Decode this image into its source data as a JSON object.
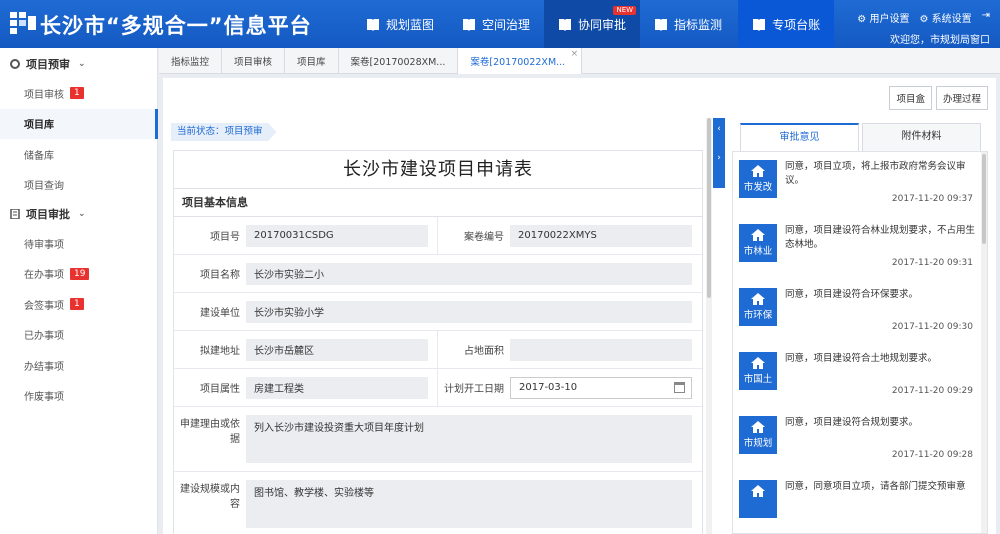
{
  "brand": {
    "title": "长沙市“多规合一”信息平台"
  },
  "nav": [
    {
      "label": "规划蓝图",
      "icon": "book-icon"
    },
    {
      "label": "空间治理",
      "icon": "book-icon"
    },
    {
      "label": "协同审批",
      "icon": "book-icon",
      "badge": "NEW"
    },
    {
      "label": "指标监测",
      "icon": "book-icon"
    },
    {
      "label": "专项台账",
      "icon": "book-icon"
    }
  ],
  "topright": {
    "user_settings": "用户设置",
    "system_settings": "系统设置",
    "welcome": "欢迎您，市规划局窗口"
  },
  "sidebar": {
    "group1": {
      "label": "项目预审"
    },
    "group1_items": [
      {
        "label": "项目审核",
        "badge": "1"
      },
      {
        "label": "项目库"
      },
      {
        "label": "储备库"
      },
      {
        "label": "项目查询"
      }
    ],
    "group2": {
      "label": "项目审批"
    },
    "group2_items": [
      {
        "label": "待审事项"
      },
      {
        "label": "在办事项",
        "badge": "19"
      },
      {
        "label": "会签事项",
        "badge": "1"
      },
      {
        "label": "已办事项"
      },
      {
        "label": "办结事项"
      },
      {
        "label": "作废事项"
      }
    ]
  },
  "tabs": [
    "指标监控",
    "项目审核",
    "项目库",
    "案卷[20170028XM...",
    "案卷[20170022XM..."
  ],
  "toolbar": {
    "project_box": "项目盒",
    "process": "办理过程"
  },
  "status": "当前状态：项目预审",
  "form": {
    "title": "长沙市建设项目申请表",
    "section": "项目基本信息",
    "project_no_label": "项目号",
    "project_no": "20170031CSDG",
    "case_no_label": "案卷编号",
    "case_no": "20170022XMYS",
    "name_label": "项目名称",
    "name": "长沙市实验二小",
    "unit_label": "建设单位",
    "unit": "长沙市实验小学",
    "address_label": "拟建地址",
    "address": "长沙市岳麓区",
    "area_label": "占地面积",
    "area": "",
    "attr_label": "项目属性",
    "attr": "房建工程类",
    "start_label": "计划开工日期",
    "start": "2017-03-10",
    "reason_label": "申建理由或依据",
    "reason": "列入长沙市建设投资重大项目年度计划",
    "scale_label": "建设规模或内容",
    "scale": "图书馆、教学楼、实验楼等"
  },
  "right": {
    "tab_opinions": "审批意见",
    "tab_materials": "附件材料",
    "opinions": [
      {
        "dept": "市发改",
        "text": "同意，项目立项，将上报市政府常务会议审议。",
        "time": "2017-11-20 09:37"
      },
      {
        "dept": "市林业",
        "text": "同意，项目建设符合林业规划要求，不占用生态林地。",
        "time": "2017-11-20 09:31"
      },
      {
        "dept": "市环保",
        "text": "同意，项目建设符合环保要求。",
        "time": "2017-11-20 09:30"
      },
      {
        "dept": "市国土",
        "text": "同意，项目建设符合土地规划要求。",
        "time": "2017-11-20 09:29"
      },
      {
        "dept": "市规划",
        "text": "同意，项目建设符合规划要求。",
        "time": "2017-11-20 09:28"
      },
      {
        "dept": "",
        "text": "同意，同意项目立项，请各部门提交预审意",
        "time": ""
      }
    ]
  }
}
